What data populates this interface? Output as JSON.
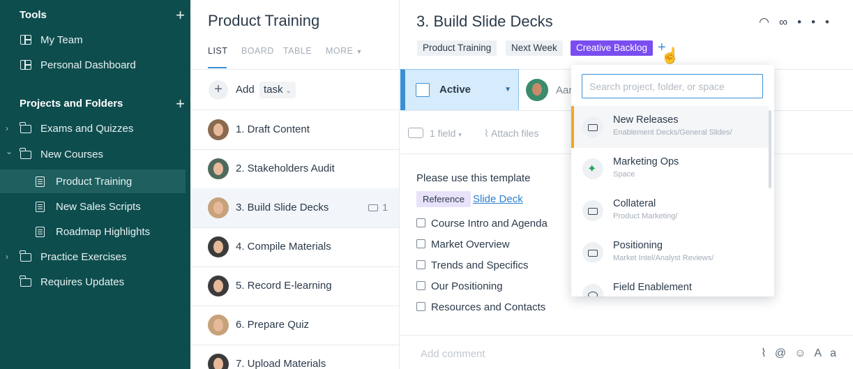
{
  "sidebar": {
    "tools_heading": "Tools",
    "tools_items": [
      {
        "label": "My Team",
        "icon": "dashboard-icon"
      },
      {
        "label": "Personal Dashboard",
        "icon": "dashboard-icon"
      }
    ],
    "projects_heading": "Projects and Folders",
    "tree": [
      {
        "label": "Exams and Quizzes",
        "icon": "folder-icon",
        "expander": "›"
      },
      {
        "label": "New Courses",
        "icon": "folder-icon",
        "expander": "⌄"
      },
      {
        "label": "Product Training",
        "icon": "project-icon",
        "active": true
      },
      {
        "label": "New Sales Scripts",
        "icon": "project-icon"
      },
      {
        "label": "Roadmap Highlights",
        "icon": "project-icon"
      },
      {
        "label": "Practice Exercises",
        "icon": "folder-icon",
        "expander": "›"
      },
      {
        "label": "Requires Updates",
        "icon": "folder-icon"
      }
    ],
    "accent": "#0e4d4e"
  },
  "list": {
    "title": "Product Training",
    "tabs": [
      "LIST",
      "BOARD",
      "TABLE",
      "MORE"
    ],
    "add_label": "Add",
    "add_type": "task",
    "tasks": [
      {
        "name": "1. Draft Content"
      },
      {
        "name": "2. Stakeholders Audit"
      },
      {
        "name": "3. Build Slide Decks",
        "meta": "1",
        "selected": true
      },
      {
        "name": "4. Compile Materials"
      },
      {
        "name": "5. Record E-learning"
      },
      {
        "name": "6. Prepare Quiz"
      },
      {
        "name": "7. Upload Materials"
      }
    ]
  },
  "detail": {
    "title": "3. Build Slide Decks",
    "tags": [
      "Product Training",
      "Next Week",
      "Creative Backlog"
    ],
    "status": "Active",
    "assignee": "Aar",
    "fields_label": "1 field",
    "attach_label": "Attach files",
    "description": "Please use this template",
    "reference_tag": "Reference",
    "reference_link": "Slide Deck",
    "checklist": [
      "Course Intro and Agenda",
      "Market Overview",
      "Trends and Specifics",
      "Our Positioning",
      "Resources and Contacts"
    ],
    "comment_placeholder": "Add comment",
    "comment_tools_text": "Aa",
    "tag_accent": "#7a4df0",
    "status_accent": "#3a8fd6"
  },
  "dropdown": {
    "search_placeholder": "Search project, folder, or space",
    "items": [
      {
        "name": "New Releases",
        "path": "Enablement Decks/General Slides/",
        "icon": "folder-icon",
        "hover": true
      },
      {
        "name": "Marketing Ops",
        "path": "Space",
        "icon": "space-icon"
      },
      {
        "name": "Collateral",
        "path": "Product Marketing/",
        "icon": "folder-icon"
      },
      {
        "name": "Positioning",
        "path": "Market Intel/Analyst Reviews/",
        "icon": "folder-icon"
      },
      {
        "name": "Field Enablement",
        "path": "",
        "icon": "space-icon"
      }
    ],
    "hover_accent": "#f5a623"
  }
}
